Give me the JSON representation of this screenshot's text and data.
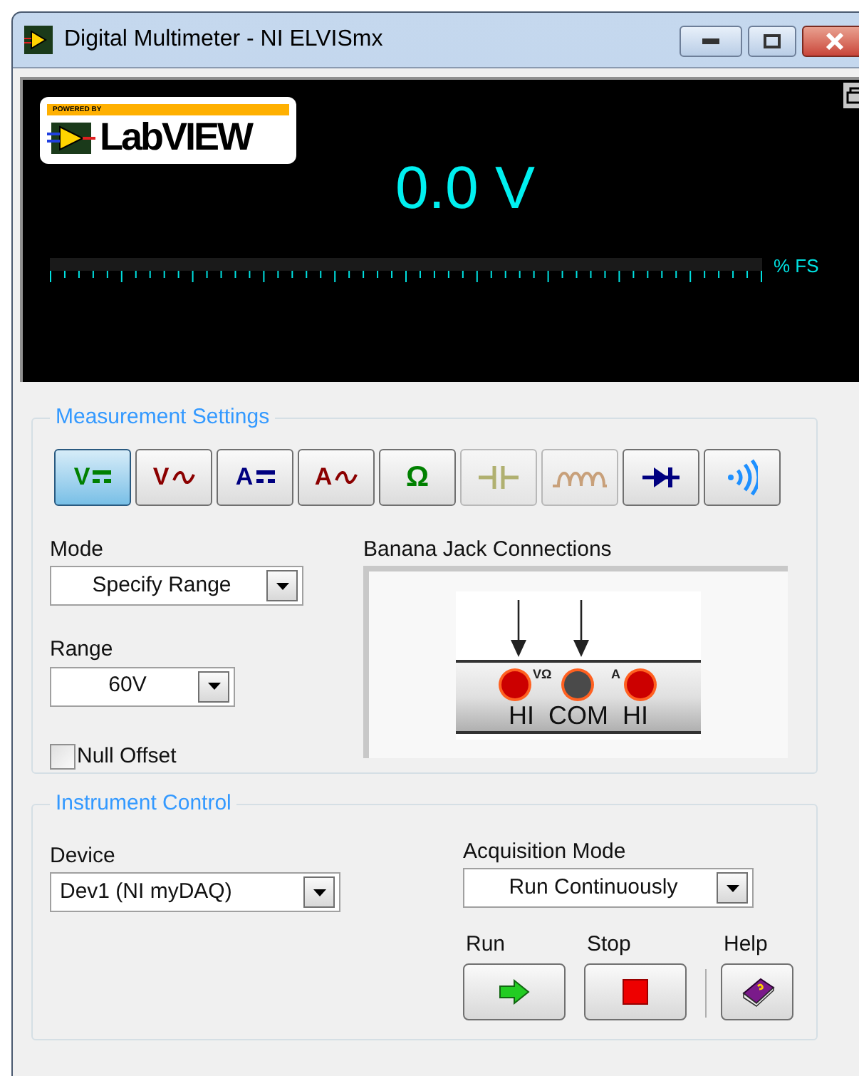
{
  "window": {
    "title": "Digital Multimeter - NI ELVISmx"
  },
  "logo": {
    "tagline": "POWERED BY",
    "name": "LabVIEW"
  },
  "display": {
    "reading": "0.0 V",
    "meter": {
      "unit": "% FS"
    }
  },
  "measurement_settings": {
    "title": "Measurement Settings",
    "functions": [
      {
        "kind": "dc",
        "label": "V",
        "color": "#008000",
        "selected": true,
        "disabled": false
      },
      {
        "kind": "ac",
        "label": "V",
        "color": "#8b0000",
        "selected": false,
        "disabled": false
      },
      {
        "kind": "dc",
        "label": "A",
        "color": "#000080",
        "selected": false,
        "disabled": false
      },
      {
        "kind": "ac",
        "label": "A",
        "color": "#8b0000",
        "selected": false,
        "disabled": false
      },
      {
        "kind": "text",
        "label": "Ω",
        "color": "#008000",
        "selected": false,
        "disabled": false
      },
      {
        "kind": "capacitor",
        "color": "#b0b070",
        "selected": false,
        "disabled": true
      },
      {
        "kind": "inductor",
        "color": "#c8a07a",
        "selected": false,
        "disabled": true
      },
      {
        "kind": "diode",
        "color": "#000080",
        "selected": false,
        "disabled": false
      },
      {
        "kind": "continuity",
        "color": "#1e90ff",
        "selected": false,
        "disabled": false
      }
    ],
    "mode": {
      "label": "Mode",
      "value": "Specify Range"
    },
    "range": {
      "label": "Range",
      "value": "60V"
    },
    "null_offset": {
      "label": "Null Offset",
      "checked": false
    },
    "banana_jacks": {
      "title": "Banana Jack Connections",
      "markings": [
        "VΩ",
        "A"
      ],
      "jacks": [
        {
          "label": "HI",
          "color": "#cc0000",
          "arrow": true
        },
        {
          "label": "COM",
          "color": "#4a4a4a",
          "arrow": true
        },
        {
          "label": "HI",
          "color": "#cc0000",
          "arrow": false
        }
      ]
    }
  },
  "instrument_control": {
    "title": "Instrument Control",
    "device": {
      "label": "Device",
      "value": "Dev1 (NI myDAQ)"
    },
    "acquisition_mode": {
      "label": "Acquisition Mode",
      "value": "Run Continuously"
    },
    "buttons": [
      {
        "kind": "run",
        "label": "Run"
      },
      {
        "kind": "stop",
        "label": "Stop"
      },
      {
        "kind": "help",
        "label": "Help"
      }
    ]
  }
}
